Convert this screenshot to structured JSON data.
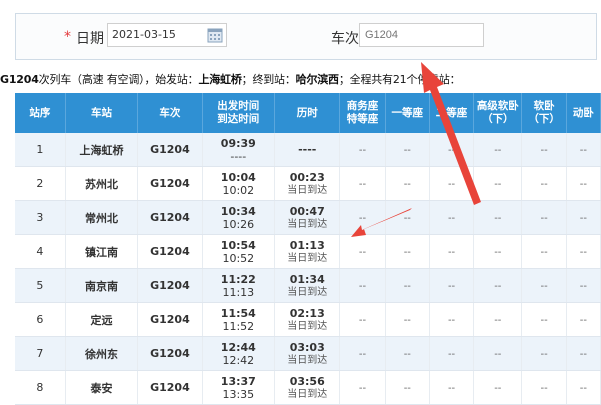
{
  "form": {
    "date_label": "日期",
    "date_required": "*",
    "date_value": "2021-03-15",
    "train_label": "车次",
    "train_placeholder": "G1204"
  },
  "summary": {
    "train": "G1204",
    "text1": "次列车（高速 有空调），始发站：",
    "origin": "上海虹桥",
    "text2": "；终到站：",
    "dest": "哈尔滨西",
    "text3": "；全程共有21个停靠站："
  },
  "table": {
    "headers": [
      "站序",
      "车站",
      "车次",
      "出发时间\n到达时间",
      "历时",
      "商务座\n特等座",
      "一等座",
      "二等座",
      "高级软卧\n（下）",
      "软卧\n（下）",
      "动卧"
    ],
    "rows": [
      {
        "seq": "1",
        "station": "上海虹桥",
        "train": "G1204",
        "dep": "09:39",
        "arr": "----",
        "duration": "----",
        "arrival_day": "",
        "seats": [
          "--",
          "--",
          "--",
          "--",
          "--",
          "--"
        ]
      },
      {
        "seq": "2",
        "station": "苏州北",
        "train": "G1204",
        "dep": "10:04",
        "arr": "10:02",
        "duration": "00:23",
        "arrival_day": "当日到达",
        "seats": [
          "--",
          "--",
          "--",
          "--",
          "--",
          "--"
        ]
      },
      {
        "seq": "3",
        "station": "常州北",
        "train": "G1204",
        "dep": "10:34",
        "arr": "10:26",
        "duration": "00:47",
        "arrival_day": "当日到达",
        "seats": [
          "--",
          "--",
          "--",
          "--",
          "--",
          "--"
        ]
      },
      {
        "seq": "4",
        "station": "镇江南",
        "train": "G1204",
        "dep": "10:54",
        "arr": "10:52",
        "duration": "01:13",
        "arrival_day": "当日到达",
        "seats": [
          "--",
          "--",
          "--",
          "--",
          "--",
          "--"
        ]
      },
      {
        "seq": "5",
        "station": "南京南",
        "train": "G1204",
        "dep": "11:22",
        "arr": "11:13",
        "duration": "01:34",
        "arrival_day": "当日到达",
        "seats": [
          "--",
          "--",
          "--",
          "--",
          "--",
          "--"
        ]
      },
      {
        "seq": "6",
        "station": "定远",
        "train": "G1204",
        "dep": "11:54",
        "arr": "11:52",
        "duration": "02:13",
        "arrival_day": "当日到达",
        "seats": [
          "--",
          "--",
          "--",
          "--",
          "--",
          "--"
        ]
      },
      {
        "seq": "7",
        "station": "徐州东",
        "train": "G1204",
        "dep": "12:44",
        "arr": "12:42",
        "duration": "03:03",
        "arrival_day": "当日到达",
        "seats": [
          "--",
          "--",
          "--",
          "--",
          "--",
          "--"
        ]
      },
      {
        "seq": "8",
        "station": "泰安",
        "train": "G1204",
        "dep": "13:37",
        "arr": "13:35",
        "duration": "03:56",
        "arrival_day": "当日到达",
        "seats": [
          "--",
          "--",
          "--",
          "--",
          "--",
          "--"
        ]
      }
    ]
  },
  "annotation": {
    "arrow_color": "#e8443a"
  }
}
